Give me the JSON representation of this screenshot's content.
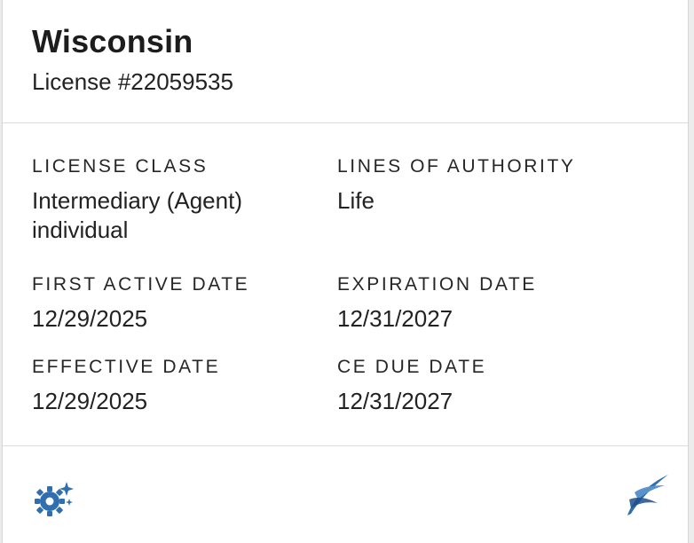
{
  "header": {
    "state": "Wisconsin",
    "license_number": "License #22059535"
  },
  "fields": {
    "license_class": {
      "label": "LICENSE CLASS",
      "value": "Intermediary (Agent) individual"
    },
    "lines_of_authority": {
      "label": "LINES OF AUTHORITY",
      "value": "Life"
    },
    "first_active_date": {
      "label": "FIRST ACTIVE DATE",
      "value": "12/29/2025"
    },
    "expiration_date": {
      "label": "EXPIRATION DATE",
      "value": "12/31/2027"
    },
    "effective_date": {
      "label": "EFFECTIVE DATE",
      "value": "12/29/2025"
    },
    "ce_due_date": {
      "label": "CE DUE DATE",
      "value": "12/31/2027"
    }
  },
  "footer": {
    "left_icon": "gear-sparkle-icon",
    "right_icon": "swoosh-logo-icon",
    "accent_color": "#2f6fb0"
  }
}
